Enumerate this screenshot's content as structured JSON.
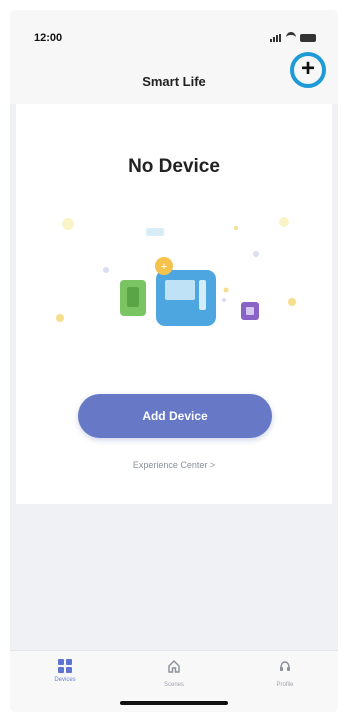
{
  "status_bar": {
    "time": "12:00"
  },
  "header": {
    "title": "Smart Life",
    "add_button_icon": "plus-icon",
    "add_label": "+"
  },
  "main": {
    "title": "No Device",
    "add_device_label": "Add Device",
    "experience_link": "Experience Center >"
  },
  "tabs": [
    {
      "label": "Devices",
      "icon": "grid-icon",
      "active": true
    },
    {
      "label": "Scenes",
      "icon": "home-icon",
      "active": false
    },
    {
      "label": "Profile",
      "icon": "profile-icon",
      "active": false
    }
  ],
  "colors": {
    "accent": "#6678c6",
    "highlight_ring": "#1e9bd7",
    "background": "#f0f1f4"
  }
}
